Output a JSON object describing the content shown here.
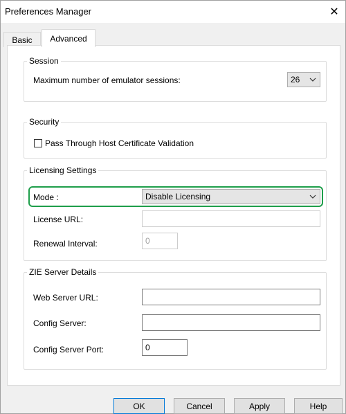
{
  "window": {
    "title": "Preferences Manager",
    "close_glyph": "✕"
  },
  "tabs": [
    {
      "label": "Basic"
    },
    {
      "label": "Advanced"
    }
  ],
  "session": {
    "legend": "Session",
    "max_sessions_label": "Maximum number of emulator sessions:",
    "max_sessions_value": "26"
  },
  "security": {
    "legend": "Security",
    "pass_through_label": "Pass Through Host Certificate Validation",
    "pass_through_checked": false
  },
  "licensing": {
    "legend": "Licensing Settings",
    "mode_label": "Mode :",
    "mode_value": "Disable Licensing",
    "license_url_label": "License URL:",
    "license_url_value": "",
    "renewal_interval_label": "Renewal Interval:",
    "renewal_interval_value": "0"
  },
  "zie": {
    "legend": "ZIE Server Details",
    "web_server_url_label": "Web Server URL:",
    "web_server_url_value": "",
    "config_server_label": "Config Server:",
    "config_server_value": "",
    "config_server_port_label": "Config Server Port:",
    "config_server_port_value": "0"
  },
  "buttons": {
    "ok": "OK",
    "cancel": "Cancel",
    "apply": "Apply",
    "help": "Help"
  },
  "colors": {
    "highlight": "#1e9e4a",
    "default_button_border": "#0078d7"
  }
}
